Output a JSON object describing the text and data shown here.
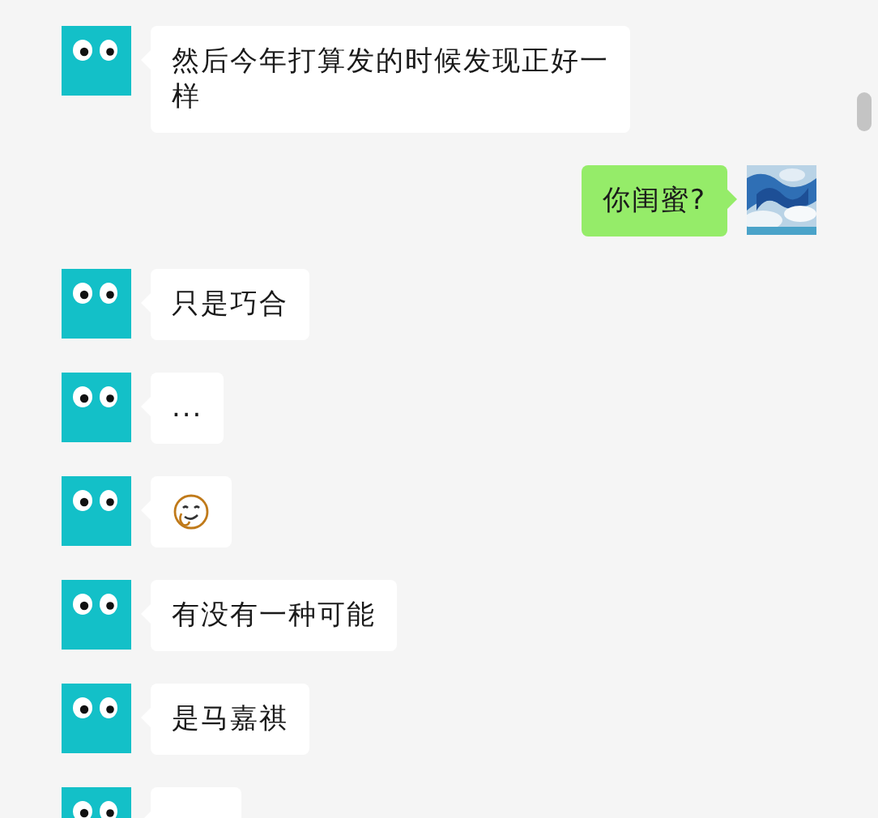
{
  "messages": [
    {
      "outgoing": false,
      "kind": "text",
      "text": "然后今年打算发的时候发现正好一样"
    },
    {
      "outgoing": true,
      "kind": "text",
      "text": "你闺蜜?"
    },
    {
      "outgoing": false,
      "kind": "text",
      "text": "只是巧合"
    },
    {
      "outgoing": false,
      "kind": "text",
      "text": "..."
    },
    {
      "outgoing": false,
      "kind": "emoji"
    },
    {
      "outgoing": false,
      "kind": "text",
      "text": "有没有一种可能"
    },
    {
      "outgoing": false,
      "kind": "text",
      "text": "是马嘉祺"
    },
    {
      "outgoing": false,
      "kind": "cut"
    }
  ]
}
